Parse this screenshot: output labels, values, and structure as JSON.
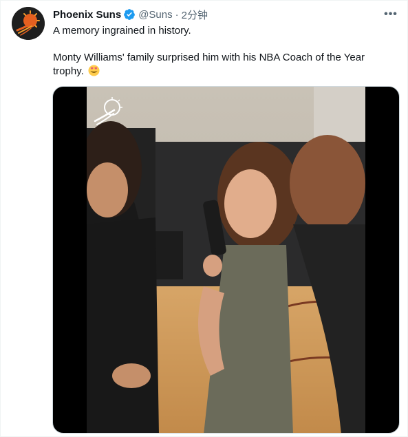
{
  "tweet": {
    "author_name": "Phoenix Suns",
    "author_handle": "@Suns",
    "separator": "·",
    "timestamp": "2分钟",
    "verified": true,
    "more_label": "•••",
    "text_line1": "A memory ingrained in history.",
    "text_line2": "Monty Williams' family surprised him with his NBA Coach of the Year trophy.",
    "emoji": "smiling-face-with-heart-eyes"
  },
  "colors": {
    "verified_blue": "#1d9bf0",
    "secondary_text": "#536471",
    "primary_text": "#0f1419",
    "suns_orange": "#e56020",
    "suns_purple": "#1d1160"
  },
  "media": {
    "type": "video",
    "watermark": "suns-logo"
  }
}
